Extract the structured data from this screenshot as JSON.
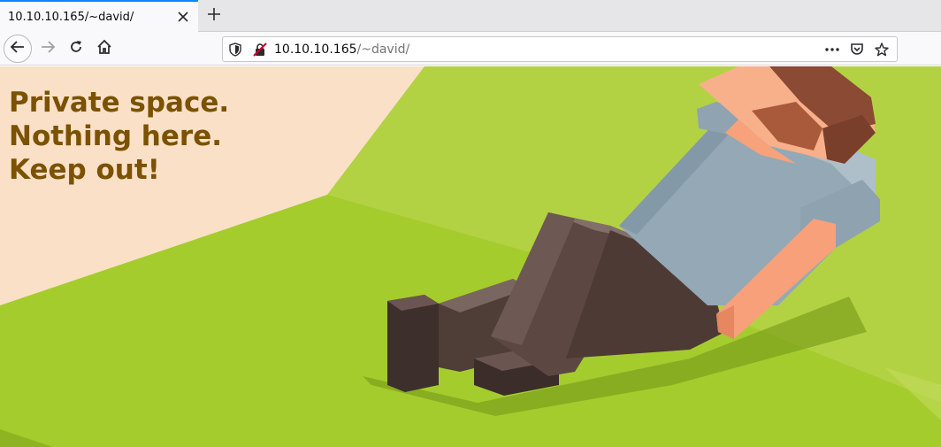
{
  "browser": {
    "tab": {
      "title": "10.10.10.165/~david/"
    },
    "url": {
      "host": "10.10.10.165",
      "path": "/~david/"
    },
    "accent_color": "#0a84ff",
    "icons": {
      "tab_close": "close-icon",
      "new_tab": "plus-icon",
      "back": "arrow-left-icon",
      "forward": "arrow-right-icon",
      "reload": "reload-icon",
      "home": "home-icon",
      "tracking": "shield-icon",
      "connection": "insecure-lock-icon",
      "page_actions": "more-icon",
      "pocket": "pocket-icon",
      "bookmark": "star-icon"
    }
  },
  "page": {
    "message_lines": [
      "Private space.",
      "Nothing here.",
      "Keep out!"
    ],
    "text_color": "#7a5200",
    "background": {
      "description_colors": {
        "grass": "#a5cc2d",
        "grass_light": "#b5d447",
        "sand": "#fbe0c8",
        "shirt": "#94a8b4",
        "pants": "#5a4440",
        "skin": "#f8a27a",
        "hair": "#8a4a32"
      }
    }
  }
}
